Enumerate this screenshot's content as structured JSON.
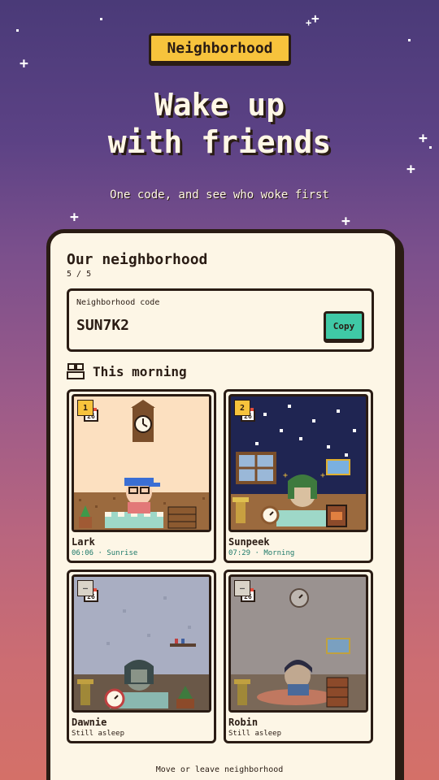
{
  "app": {
    "badge": "Neighborhood",
    "title_line1": "Wake up",
    "title_line2": "with friends",
    "subtitle": "One code, and see who woke first"
  },
  "panel": {
    "title": "Our neighborhood",
    "count": "5 / 5",
    "code_label": "Neighborhood code",
    "code_value": "SUN7K2",
    "copy_label": "Copy",
    "section_label": "This morning",
    "footer_link": "Move or leave neighborhood"
  },
  "friends": [
    {
      "rank": "1",
      "name": "Lark",
      "status": "06:06 · Sunrise",
      "cal": "26",
      "status_color": "#1e7a6a"
    },
    {
      "rank": "2",
      "name": "Sunpeek",
      "status": "07:29 · Morning",
      "cal": "26",
      "status_color": "#1e7a6a"
    },
    {
      "rank": "–",
      "name": "Dawnie",
      "status": "Still asleep",
      "cal": "26",
      "status_color": "#2a1c14"
    },
    {
      "rank": "–",
      "name": "Robin",
      "status": "Still asleep",
      "cal": "26",
      "status_color": "#2a1c14"
    }
  ],
  "colors": {
    "accent_yellow": "#f7c33c",
    "accent_teal": "#3fc9a6",
    "ink": "#2a1c14",
    "paper": "#fdf6e6"
  }
}
